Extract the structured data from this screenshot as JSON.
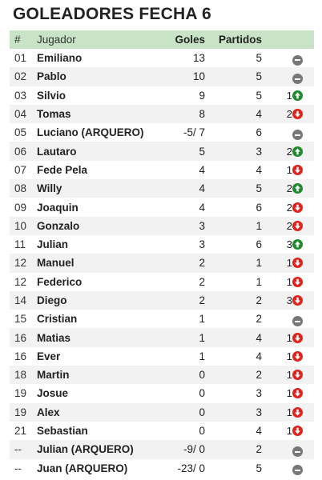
{
  "title": "GOLEADORES FECHA 6",
  "headers": {
    "num": "#",
    "player": "Jugador",
    "goals": "Goles",
    "matches": "Partidos"
  },
  "colors": {
    "header_bg": "#c9e3c6",
    "up": "#1f8b2c",
    "down": "#e0241b",
    "neutral": "#777777"
  },
  "rows": [
    {
      "pos": "01",
      "name": "Emiliano",
      "goals": "13",
      "matches": "5",
      "change": "",
      "trend": "neutral"
    },
    {
      "pos": "02",
      "name": "Pablo",
      "goals": "10",
      "matches": "5",
      "change": "",
      "trend": "neutral"
    },
    {
      "pos": "03",
      "name": "Silvio",
      "goals": "9",
      "matches": "5",
      "change": "1",
      "trend": "up"
    },
    {
      "pos": "04",
      "name": "Tomas",
      "goals": "8",
      "matches": "4",
      "change": "2",
      "trend": "down"
    },
    {
      "pos": "05",
      "name": "Luciano (ARQUERO)",
      "goals": "-5/ 7",
      "matches": "6",
      "change": "",
      "trend": "neutral"
    },
    {
      "pos": "06",
      "name": "Lautaro",
      "goals": "5",
      "matches": "3",
      "change": "2",
      "trend": "up"
    },
    {
      "pos": "07",
      "name": "Fede Pela",
      "goals": "4",
      "matches": "4",
      "change": "1",
      "trend": "down"
    },
    {
      "pos": "08",
      "name": "Willy",
      "goals": "4",
      "matches": "5",
      "change": "2",
      "trend": "up"
    },
    {
      "pos": "09",
      "name": "Joaquin",
      "goals": "4",
      "matches": "6",
      "change": "2",
      "trend": "down"
    },
    {
      "pos": "10",
      "name": "Gonzalo",
      "goals": "3",
      "matches": "1",
      "change": "2",
      "trend": "down"
    },
    {
      "pos": "11",
      "name": "Julian",
      "goals": "3",
      "matches": "6",
      "change": "3",
      "trend": "up"
    },
    {
      "pos": "12",
      "name": "Manuel",
      "goals": "2",
      "matches": "1",
      "change": "1",
      "trend": "down"
    },
    {
      "pos": "12",
      "name": "Federico",
      "goals": "2",
      "matches": "1",
      "change": "1",
      "trend": "down"
    },
    {
      "pos": "14",
      "name": "Diego",
      "goals": "2",
      "matches": "2",
      "change": "3",
      "trend": "down"
    },
    {
      "pos": "15",
      "name": "Cristian",
      "goals": "1",
      "matches": "2",
      "change": "",
      "trend": "neutral"
    },
    {
      "pos": "16",
      "name": "Matias",
      "goals": "1",
      "matches": "4",
      "change": "1",
      "trend": "down"
    },
    {
      "pos": "16",
      "name": "Ever",
      "goals": "1",
      "matches": "4",
      "change": "1",
      "trend": "down"
    },
    {
      "pos": "18",
      "name": "Martin",
      "goals": "0",
      "matches": "2",
      "change": "1",
      "trend": "down"
    },
    {
      "pos": "19",
      "name": "Josue",
      "goals": "0",
      "matches": "3",
      "change": "1",
      "trend": "down"
    },
    {
      "pos": "19",
      "name": "Alex",
      "goals": "0",
      "matches": "3",
      "change": "1",
      "trend": "down"
    },
    {
      "pos": "21",
      "name": "Sebastian",
      "goals": "0",
      "matches": "4",
      "change": "1",
      "trend": "down"
    },
    {
      "pos": "--",
      "name": "Julian (ARQUERO)",
      "goals": "-9/ 0",
      "matches": "2",
      "change": "",
      "trend": "neutral"
    },
    {
      "pos": "--",
      "name": "Juan (ARQUERO)",
      "goals": "-23/ 0",
      "matches": "5",
      "change": "",
      "trend": "neutral"
    }
  ]
}
